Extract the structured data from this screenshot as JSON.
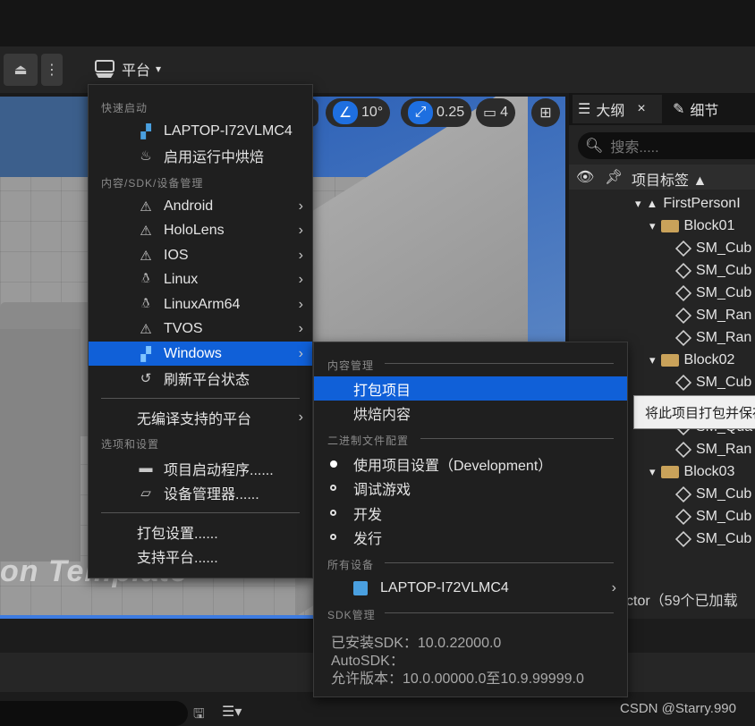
{
  "toolbar": {
    "platform_label": "平台"
  },
  "viewport": {
    "chip_angle_value": "10°",
    "chip_scale_value": "0.25",
    "chip_camera_value": "4",
    "template_text": "on Template"
  },
  "outliner": {
    "tab_outliner": "大纲",
    "tab_close": "×",
    "tab_details": "细节",
    "search_placeholder": "搜索.....",
    "column_label": "项目标签 ▲",
    "tree": [
      {
        "label": "FirstPersonI",
        "kind": "level"
      },
      {
        "label": "Block01",
        "kind": "folder"
      },
      {
        "label": "SM_Cub",
        "kind": "mesh"
      },
      {
        "label": "SM_Cub",
        "kind": "mesh"
      },
      {
        "label": "SM_Cub",
        "kind": "mesh"
      },
      {
        "label": "SM_Ran",
        "kind": "mesh"
      },
      {
        "label": "SM_Ran",
        "kind": "mesh"
      },
      {
        "label": "Block02",
        "kind": "folder"
      },
      {
        "label": "SM_Cub",
        "kind": "mesh"
      },
      {
        "label": "SM_Qua",
        "kind": "mesh"
      },
      {
        "label": "SM_Qua",
        "kind": "mesh"
      },
      {
        "label": "SM_Ran",
        "kind": "mesh"
      },
      {
        "label": "Block03",
        "kind": "folder"
      },
      {
        "label": "SM_Cub",
        "kind": "mesh"
      },
      {
        "label": "SM_Cub",
        "kind": "mesh"
      },
      {
        "label": "SM_Cub",
        "kind": "mesh"
      }
    ],
    "footer": "ctor（59个已加载"
  },
  "tooltip": {
    "text": "将此项目打包并保存"
  },
  "menu": {
    "section_quick": "快速启动",
    "item_laptop": "LAPTOP-I72VLMC4",
    "item_bake": "启用运行中烘焙",
    "section_sdk": "内容/SDK/设备管理",
    "platforms": [
      "Android",
      "HoloLens",
      "IOS",
      "Linux",
      "LinuxArm64",
      "TVOS",
      "Windows"
    ],
    "item_refresh": "刷新平台状态",
    "item_unsupported": "无编译支持的平台",
    "section_options": "选项和设置",
    "item_launcher": "项目启动程序......",
    "item_devices": "设备管理器......",
    "item_package_settings": "打包设置......",
    "item_supported": "支持平台......"
  },
  "submenu": {
    "section_content": "内容管理",
    "item_package": "打包项目",
    "item_cook": "烘焙内容",
    "section_binary": "二进制文件配置",
    "configs": [
      "使用项目设置（Development）",
      "调试游戏",
      "开发",
      "发行"
    ],
    "section_devices": "所有设备",
    "device": "LAPTOP-I72VLMC4",
    "section_sdk": "SDK管理",
    "sdk_installed": "已安装SDK：10.0.22000.0",
    "sdk_auto": "AutoSDK：",
    "sdk_allowed": "允许版本：10.0.00000.0至10.9.99999.0"
  },
  "watermark": "CSDN @Starry.990",
  "colors": {
    "highlight": "#1060d8",
    "accent_blue": "#1e6fe0",
    "folder": "#c9a25a"
  }
}
